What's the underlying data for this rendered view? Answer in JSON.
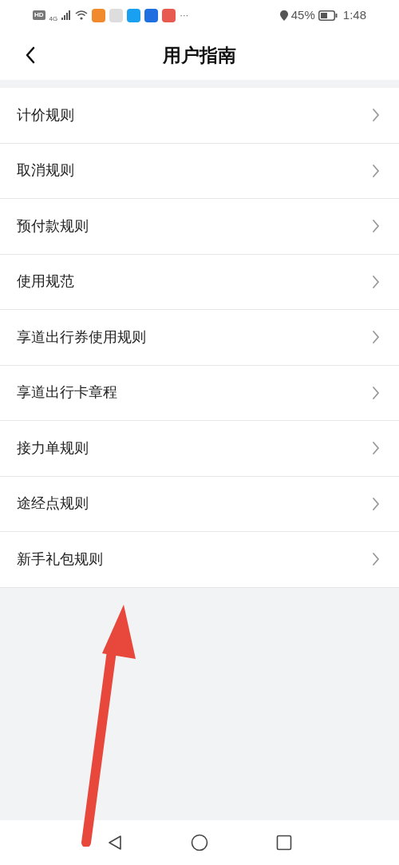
{
  "status_bar": {
    "hd": "HD",
    "network": "4G",
    "more": "···",
    "battery_percent": "45%",
    "time": "1:48"
  },
  "header": {
    "title": "用户指南"
  },
  "items": [
    {
      "label": "计价规则"
    },
    {
      "label": "取消规则"
    },
    {
      "label": "预付款规则"
    },
    {
      "label": "使用规范"
    },
    {
      "label": "享道出行券使用规则"
    },
    {
      "label": "享道出行卡章程"
    },
    {
      "label": "接力单规则"
    },
    {
      "label": "途经点规则"
    },
    {
      "label": "新手礼包规则"
    }
  ]
}
